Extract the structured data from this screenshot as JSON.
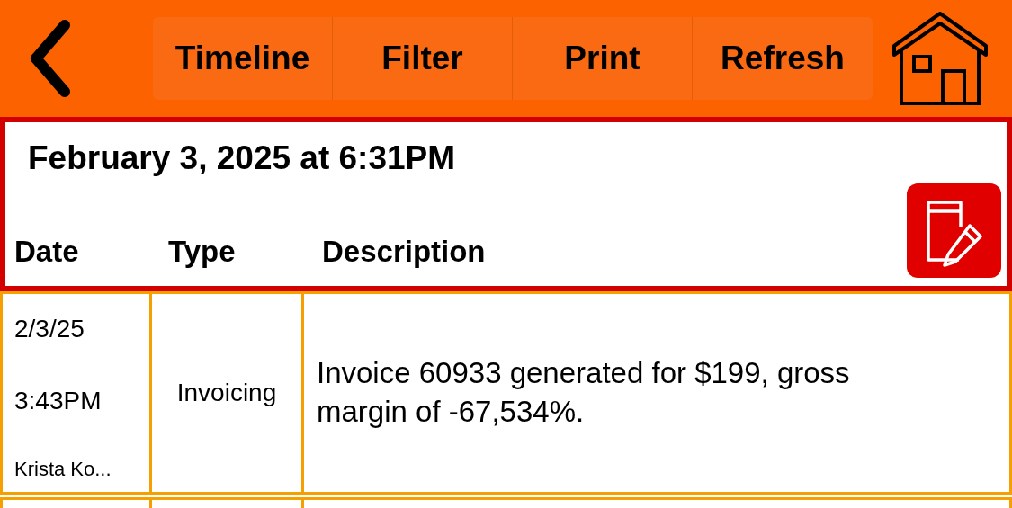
{
  "toolbar": {
    "buttons": [
      {
        "label": "Timeline"
      },
      {
        "label": "Filter"
      },
      {
        "label": "Print"
      },
      {
        "label": "Refresh"
      }
    ]
  },
  "header": {
    "title": "February 3, 2025 at 6:31PM",
    "columns": [
      "Date",
      "Type",
      "Description"
    ]
  },
  "rows": [
    {
      "date": "2/3/25",
      "time": "3:43PM",
      "user": "Krista Ko...",
      "type": "Invoicing",
      "description": "Invoice 60933 generated for $199, gross margin of -67,534%."
    }
  ]
}
